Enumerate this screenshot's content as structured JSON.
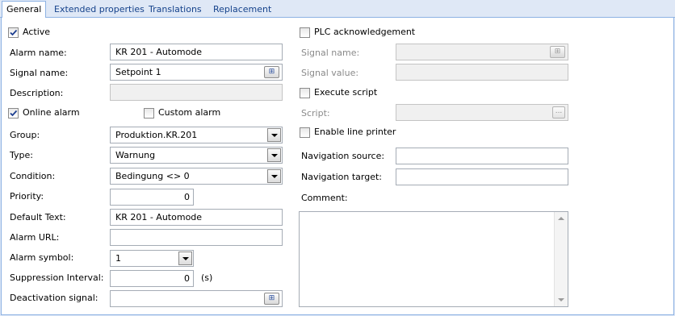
{
  "tabs": [
    {
      "label": "General",
      "active": true
    },
    {
      "label": "Extended properties",
      "active": false
    },
    {
      "label": "Translations",
      "active": false
    },
    {
      "label": "Replacement",
      "active": false
    }
  ],
  "left": {
    "active": {
      "label": "Active",
      "checked": true
    },
    "alarm_name": {
      "label": "Alarm name:",
      "value": "KR 201 - Automode"
    },
    "signal_name": {
      "label": "Signal name:",
      "value": "Setpoint 1"
    },
    "description": {
      "label": "Description:",
      "value": ""
    },
    "online_alarm": {
      "label": "Online alarm",
      "checked": true
    },
    "custom_alarm": {
      "label": "Custom alarm",
      "checked": false
    },
    "group": {
      "label": "Group:",
      "value": "Produktion.KR.201"
    },
    "type": {
      "label": "Type:",
      "value": "Warnung"
    },
    "condition": {
      "label": "Condition:",
      "value": "Bedingung <> 0"
    },
    "priority": {
      "label": "Priority:",
      "value": "0"
    },
    "default_text": {
      "label": "Default Text:",
      "value": "KR 201 - Automode"
    },
    "alarm_url": {
      "label": "Alarm URL:",
      "value": ""
    },
    "alarm_symbol": {
      "label": "Alarm symbol:",
      "value": "1"
    },
    "suppression_interval": {
      "label": "Suppression Interval:",
      "value": "0",
      "unit": "(s)"
    },
    "deactivation_signal": {
      "label": "Deactivation signal:",
      "value": ""
    }
  },
  "right": {
    "plc_ack": {
      "label": "PLC acknowledgement",
      "checked": false
    },
    "signal_name": {
      "label": "Signal name:",
      "value": ""
    },
    "signal_value": {
      "label": "Signal value:",
      "value": ""
    },
    "execute_script": {
      "label": "Execute script",
      "checked": false
    },
    "script": {
      "label": "Script:",
      "value": "",
      "button": "..."
    },
    "enable_line_printer": {
      "label": "Enable line printer",
      "checked": false
    },
    "navigation_source": {
      "label": "Navigation source:",
      "value": ""
    },
    "navigation_target": {
      "label": "Navigation target:",
      "value": ""
    },
    "comment": {
      "label": "Comment:",
      "value": ""
    }
  },
  "icons": {
    "signal_picker": "signal-picker-icon",
    "checkmark": "checkmark-icon",
    "dropdown": "chevron-down-icon"
  }
}
